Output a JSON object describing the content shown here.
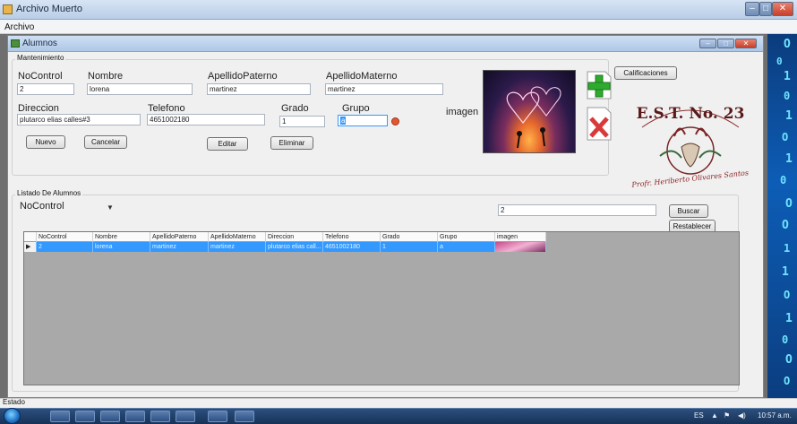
{
  "window": {
    "title": "Archivo Muerto"
  },
  "menu": {
    "archivo": "Archivo"
  },
  "form": {
    "title": "Alumnos"
  },
  "mantenimiento": {
    "group_title": "Mantenimiento",
    "labels": {
      "nocontrol": "NoControl",
      "nombre": "Nombre",
      "apellido_paterno": "ApellidoPaterno",
      "apellido_materno": "ApellidoMaterno",
      "direccion": "Direccion",
      "telefono": "Telefono",
      "grado": "Grado",
      "grupo": "Grupo",
      "imagen": "imagen"
    },
    "values": {
      "nocontrol": "2",
      "nombre": "lorena",
      "apellido_paterno": "martinez",
      "apellido_materno": "martinez",
      "direccion": "plutarco elias calles#3",
      "telefono": "4651002180",
      "grado": "1",
      "grupo": "a"
    },
    "buttons": {
      "nuevo": "Nuevo",
      "cancelar": "Cancelar",
      "editar": "Editar",
      "eliminar": "Eliminar",
      "calificaciones": "Calificaciones"
    },
    "seal_text": "E.S.T. No. 23",
    "seal_signature": "Profr. Heriberto Olivares Santos"
  },
  "listado": {
    "group_title": "Listado De Alumnos",
    "filter_selected": "NoControl",
    "search_value": "2",
    "buttons": {
      "buscar": "Buscar",
      "restablecer": "Restablecer"
    },
    "columns": [
      "NoControl",
      "Nombre",
      "ApellidoPaterno",
      "ApellidoMaterno",
      "Direccion",
      "Telefono",
      "Grado",
      "Grupo",
      "imagen"
    ],
    "rows": [
      [
        "2",
        "lorena",
        "martinez",
        "martinez",
        "plutarco elias call...",
        "4651002180",
        "1",
        "a",
        ""
      ]
    ]
  },
  "status": {
    "text": "Estado"
  },
  "tray": {
    "lang": "ES",
    "time": "10:57 a.m."
  },
  "colors": {
    "selection": "#3399ff",
    "strip": "#0d5db6",
    "add": "#2eaa2e",
    "delete": "#d83a3a"
  }
}
